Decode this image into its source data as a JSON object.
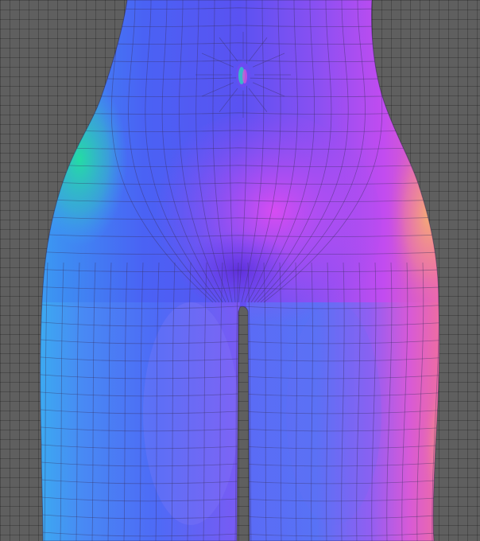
{
  "viewport": {
    "background_color": "#5f5f5f",
    "grid_line_color": "#4e4e4e",
    "grid_visible": true
  },
  "mesh": {
    "shading": "normal-map",
    "wireframe_visible": true,
    "wireframe_color": "#3a3060",
    "palette": {
      "blue": "#4a5cf4",
      "violet": "#7a4cf0",
      "magenta": "#d24cf2",
      "pink": "#f06aa8",
      "orange": "#f4a06a",
      "teal": "#2fd6a0",
      "cyan": "#38b0ee"
    }
  }
}
